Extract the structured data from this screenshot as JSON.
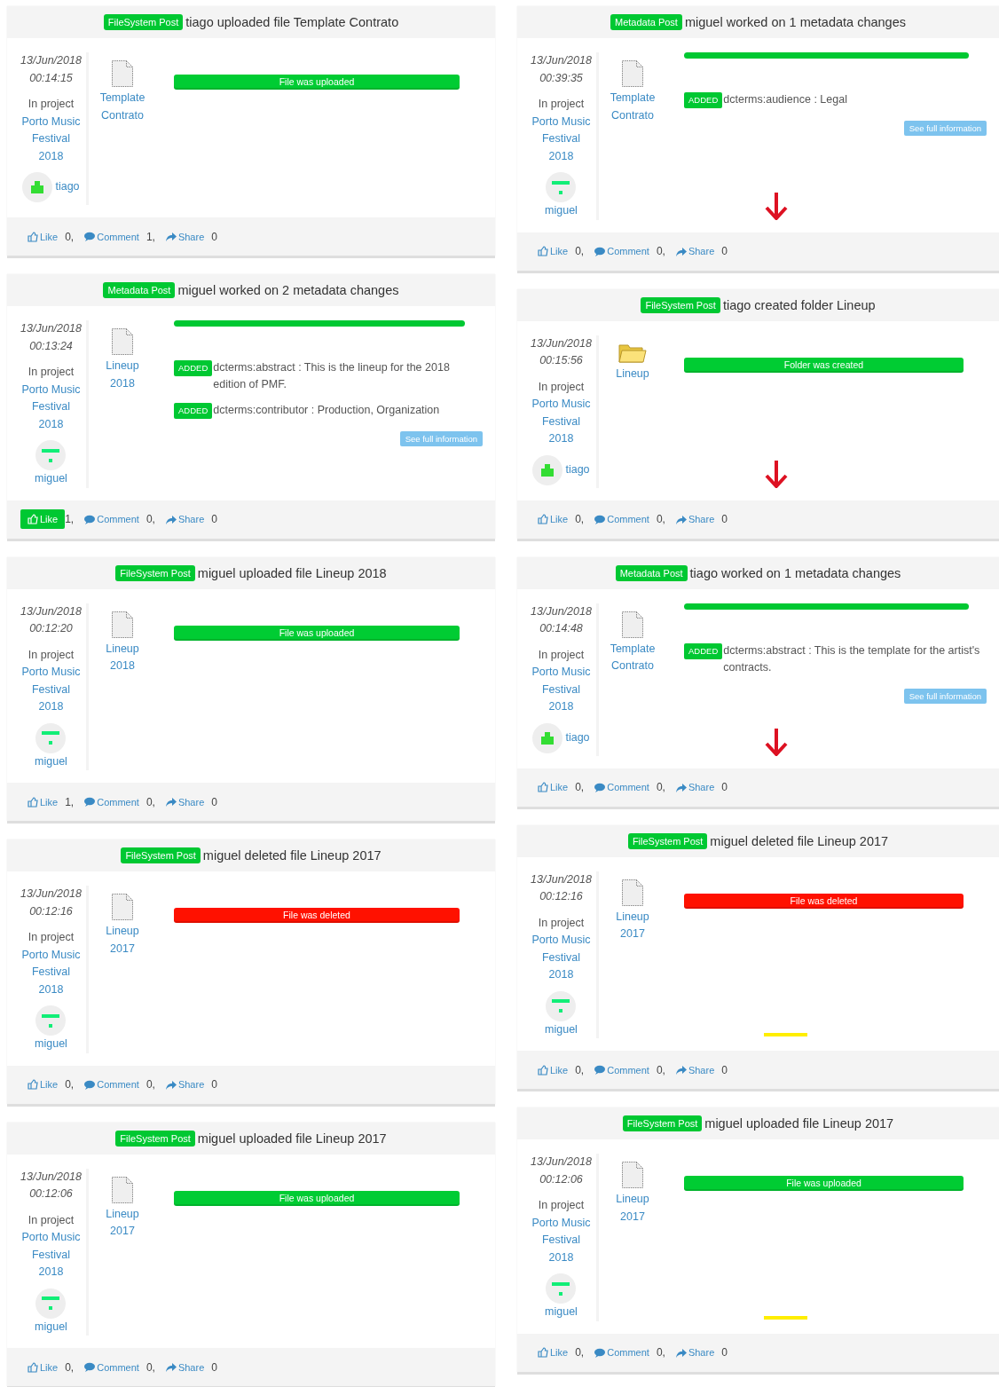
{
  "columns": [
    {
      "posts": [
        {
          "badge": "FileSystem Post",
          "title": "tiago uploaded file Template Contrato",
          "date": "13/Jun/2018",
          "time": "00:14:15",
          "project_label": "In project",
          "project": "Porto Music Festival 2018",
          "user": "tiago",
          "avatar": {
            "kind": "block"
          },
          "file": {
            "kind": "file",
            "name": "Template Contrato"
          },
          "content": {
            "kind": "status",
            "text": "File was uploaded",
            "color": "#00cc33"
          },
          "like": {
            "label": "Like",
            "count": "0,",
            "liked": false
          },
          "comment": {
            "label": "Comment",
            "count": "1,"
          },
          "share": {
            "label": "Share",
            "count": "0"
          }
        },
        {
          "badge": "Metadata Post",
          "title": "miguel worked on 2 metadata changes",
          "date": "13/Jun/2018",
          "time": "00:13:24",
          "project_label": "In project",
          "project": "Porto Music Festival 2018",
          "user": "miguel",
          "avatar": {
            "kind": "bars"
          },
          "file": {
            "kind": "file",
            "name": "Lineup 2018"
          },
          "content": {
            "kind": "changes",
            "changes": [
              {
                "tag": "ADDED",
                "text": "dcterms:abstract : This is the lineup for the 2018 edition of PMF."
              },
              {
                "tag": "ADDED",
                "text": "dcterms:contributor : Production, Organization"
              }
            ],
            "button": "See full information"
          },
          "like": {
            "label": "Like",
            "count": "1,",
            "liked": true
          },
          "comment": {
            "label": "Comment",
            "count": "0,"
          },
          "share": {
            "label": "Share",
            "count": "0"
          }
        },
        {
          "badge": "FileSystem Post",
          "title": "miguel uploaded file Lineup 2018",
          "date": "13/Jun/2018",
          "time": "00:12:20",
          "project_label": "In project",
          "project": "Porto Music Festival 2018",
          "user": "miguel",
          "avatar": {
            "kind": "bars"
          },
          "file": {
            "kind": "file",
            "name": "Lineup 2018"
          },
          "content": {
            "kind": "status",
            "text": "File was uploaded",
            "color": "#00cc33"
          },
          "like": {
            "label": "Like",
            "count": "1,",
            "liked": false
          },
          "comment": {
            "label": "Comment",
            "count": "0,"
          },
          "share": {
            "label": "Share",
            "count": "0"
          }
        },
        {
          "badge": "FileSystem Post",
          "title": "miguel deleted file Lineup 2017",
          "date": "13/Jun/2018",
          "time": "00:12:16",
          "project_label": "In project",
          "project": "Porto Music Festival 2018",
          "user": "miguel",
          "avatar": {
            "kind": "bars"
          },
          "file": {
            "kind": "file",
            "name": "Lineup 2017"
          },
          "content": {
            "kind": "status",
            "text": "File was deleted",
            "color": "#ff1100"
          },
          "like": {
            "label": "Like",
            "count": "0,",
            "liked": false
          },
          "comment": {
            "label": "Comment",
            "count": "0,"
          },
          "share": {
            "label": "Share",
            "count": "0"
          }
        },
        {
          "badge": "FileSystem Post",
          "title": "miguel uploaded file Lineup 2017",
          "date": "13/Jun/2018",
          "time": "00:12:06",
          "project_label": "In project",
          "project": "Porto Music Festival 2018",
          "user": "miguel",
          "avatar": {
            "kind": "bars"
          },
          "file": {
            "kind": "file",
            "name": "Lineup 2017"
          },
          "content": {
            "kind": "status",
            "text": "File was uploaded",
            "color": "#00cc33"
          },
          "like": {
            "label": "Like",
            "count": "0,",
            "liked": false
          },
          "comment": {
            "label": "Comment",
            "count": "0,"
          },
          "share": {
            "label": "Share",
            "count": "0"
          }
        }
      ]
    },
    {
      "posts": [
        {
          "badge": "Metadata Post",
          "title": "miguel worked on 1 metadata changes",
          "date": "13/Jun/2018",
          "time": "00:39:35",
          "project_label": "In project",
          "project": "Porto Music Festival 2018",
          "user": "miguel",
          "avatar": {
            "kind": "bars"
          },
          "file": {
            "kind": "file",
            "name": "Template Contrato"
          },
          "content": {
            "kind": "changes",
            "changes": [
              {
                "tag": "ADDED",
                "text": "dcterms:audience : Legal"
              }
            ],
            "button": "See full information"
          },
          "marker": {
            "kind": "arrow"
          },
          "like": {
            "label": "Like",
            "count": "0,",
            "liked": false
          },
          "comment": {
            "label": "Comment",
            "count": "0,"
          },
          "share": {
            "label": "Share",
            "count": "0"
          }
        },
        {
          "badge": "FileSystem Post",
          "title": "tiago created folder Lineup",
          "date": "13/Jun/2018",
          "time": "00:15:56",
          "project_label": "In project",
          "project": "Porto Music Festival 2018",
          "user": "tiago",
          "avatar": {
            "kind": "block"
          },
          "file": {
            "kind": "folder",
            "name": "Lineup"
          },
          "content": {
            "kind": "status",
            "text": "Folder was created",
            "color": "#00cc33"
          },
          "marker": {
            "kind": "arrow"
          },
          "like": {
            "label": "Like",
            "count": "0,",
            "liked": false
          },
          "comment": {
            "label": "Comment",
            "count": "0,"
          },
          "share": {
            "label": "Share",
            "count": "0"
          }
        },
        {
          "badge": "Metadata Post",
          "title": "tiago worked on 1 metadata changes",
          "date": "13/Jun/2018",
          "time": "00:14:48",
          "project_label": "In project",
          "project": "Porto Music Festival 2018",
          "user": "tiago",
          "avatar": {
            "kind": "block"
          },
          "file": {
            "kind": "file",
            "name": "Template Contrato"
          },
          "content": {
            "kind": "changes",
            "changes": [
              {
                "tag": "ADDED",
                "text": "dcterms:abstract : This is the template for the artist's contracts."
              }
            ],
            "button": "See full information"
          },
          "marker": {
            "kind": "arrow"
          },
          "like": {
            "label": "Like",
            "count": "0,",
            "liked": false
          },
          "comment": {
            "label": "Comment",
            "count": "0,"
          },
          "share": {
            "label": "Share",
            "count": "0"
          }
        },
        {
          "badge": "FileSystem Post",
          "title": "miguel deleted file Lineup 2017",
          "date": "13/Jun/2018",
          "time": "00:12:16",
          "project_label": "In project",
          "project": "Porto Music Festival 2018",
          "user": "miguel",
          "avatar": {
            "kind": "bars"
          },
          "file": {
            "kind": "file",
            "name": "Lineup 2017"
          },
          "content": {
            "kind": "status",
            "text": "File was deleted",
            "color": "#ff1100"
          },
          "marker": {
            "kind": "dash"
          },
          "like": {
            "label": "Like",
            "count": "0,",
            "liked": false
          },
          "comment": {
            "label": "Comment",
            "count": "0,"
          },
          "share": {
            "label": "Share",
            "count": "0"
          }
        },
        {
          "badge": "FileSystem Post",
          "title": "miguel uploaded file Lineup 2017",
          "date": "13/Jun/2018",
          "time": "00:12:06",
          "project_label": "In project",
          "project": "Porto Music Festival 2018",
          "user": "miguel",
          "avatar": {
            "kind": "bars"
          },
          "file": {
            "kind": "file",
            "name": "Lineup 2017"
          },
          "content": {
            "kind": "status",
            "text": "File was uploaded",
            "color": "#00cc33"
          },
          "marker": {
            "kind": "dash"
          },
          "like": {
            "label": "Like",
            "count": "0,",
            "liked": false
          },
          "comment": {
            "label": "Comment",
            "count": "0,"
          },
          "share": {
            "label": "Share",
            "count": "0"
          }
        }
      ]
    }
  ]
}
